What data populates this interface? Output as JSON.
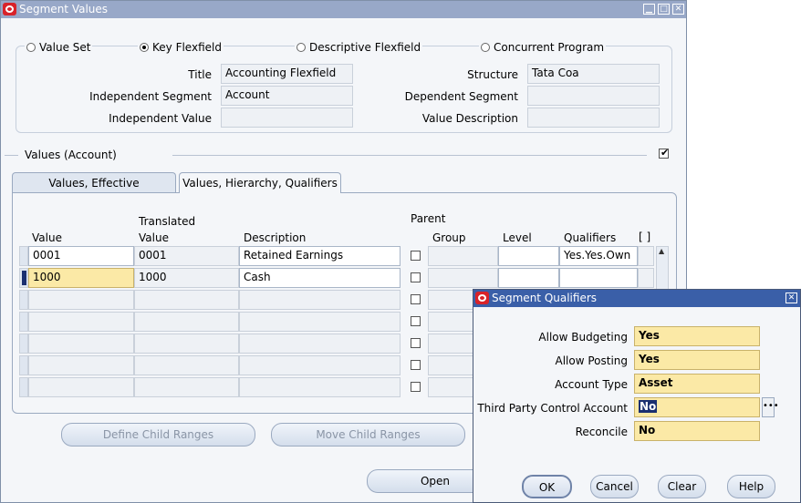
{
  "window": {
    "title": "Segment Values"
  },
  "radios": [
    {
      "label": "Value Set",
      "selected": false
    },
    {
      "label": "Key Flexfield",
      "selected": true
    },
    {
      "label": "Descriptive Flexfield",
      "selected": false
    },
    {
      "label": "Concurrent Program",
      "selected": false
    }
  ],
  "header": {
    "title_label": "Title",
    "title_value": "Accounting Flexfield",
    "structure_label": "Structure",
    "structure_value": "Tata Coa",
    "indep_seg_label": "Independent Segment",
    "indep_seg_value": "Account",
    "dep_seg_label": "Dependent Segment",
    "dep_seg_value": "",
    "indep_val_label": "Independent Value",
    "indep_val_value": "",
    "val_desc_label": "Value Description",
    "val_desc_value": ""
  },
  "values_section": {
    "title": "Values (Account)"
  },
  "tabs": [
    {
      "label": "Values, Effective",
      "active": false
    },
    {
      "label": "Values, Hierarchy, Qualifiers",
      "active": true
    }
  ],
  "columns": {
    "value": "Value",
    "translated_1": "Translated",
    "translated_2": "Value",
    "description": "Description",
    "parent": "Parent",
    "group": "Group",
    "level": "Level",
    "qualifiers": "Qualifiers",
    "brackets": "[ ]"
  },
  "rows": [
    {
      "value": "0001",
      "translated": "0001",
      "description": "Retained Earnings",
      "qualifiers": "Yes.Yes.Own"
    },
    {
      "value": "1000",
      "translated": "1000",
      "description": "Cash",
      "qualifiers": ""
    }
  ],
  "buttons": {
    "define_child": "Define Child Ranges",
    "move_child": "Move Child Ranges",
    "open": "Open"
  },
  "qualifier_dialog": {
    "title": "Segment Qualifiers",
    "fields": [
      {
        "label": "Allow Budgeting",
        "value": "Yes"
      },
      {
        "label": "Allow Posting",
        "value": "Yes"
      },
      {
        "label": "Account Type",
        "value": "Asset"
      },
      {
        "label": "Third Party Control Account",
        "value": "No"
      },
      {
        "label": "Reconcile",
        "value": "No"
      }
    ],
    "ok": "OK",
    "cancel": "Cancel",
    "clear": "Clear",
    "help": "Help"
  }
}
